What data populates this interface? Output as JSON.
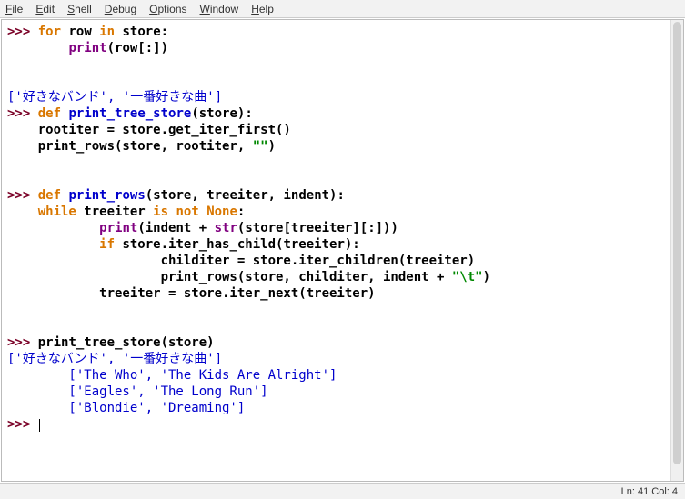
{
  "menu": {
    "file": "File",
    "edit": "Edit",
    "shell": "Shell",
    "debug": "Debug",
    "options": "Options",
    "window": "Window",
    "help": "Help"
  },
  "status": {
    "text": "Ln: 41  Col: 4"
  },
  "code": {
    "prompt": ">>>",
    "cont": "   ",
    "l1a": "for",
    "l1b": " row ",
    "l1c": "in",
    "l1d": " store:",
    "l2a": "        ",
    "l2b": "print",
    "l2c": "(row[:])",
    "blank": "",
    "out1": "['好きなバンド', '一番好きな曲']",
    "l5a": "def",
    "l5b": " ",
    "l5c": "print_tree_store",
    "l5d": "(store):",
    "l6": "    rootiter = store.get_iter_first()",
    "l7a": "    print_rows(store, rootiter, ",
    "l7b": "\"\"",
    "l7c": ")",
    "l10a": "def",
    "l10b": " ",
    "l10c": "print_rows",
    "l10d": "(store, treeiter, indent):",
    "l11a": "    ",
    "l11b": "while",
    "l11c": " treeiter ",
    "l11d": "is not",
    "l11e": " ",
    "l11f": "None",
    "l11g": ":",
    "l12a": "            ",
    "l12b": "print",
    "l12c": "(indent + ",
    "l12d": "str",
    "l12e": "(store[treeiter][:]))",
    "l13a": "            ",
    "l13b": "if",
    "l13c": " store.iter_has_child(treeiter):",
    "l14": "                    childiter = store.iter_children(treeiter)",
    "l15a": "                    print_rows(store, childiter, indent + ",
    "l15b": "\"\\t\"",
    "l15c": ")",
    "l16": "            treeiter = store.iter_next(treeiter)",
    "l19": "print_tree_store(store)",
    "out2": "['好きなバンド', '一番好きな曲']",
    "out3": "        ['The Who', 'The Kids Are Alright']",
    "out4": "        ['Eagles', 'The Long Run']",
    "out5": "        ['Blondie', 'Dreaming']"
  }
}
